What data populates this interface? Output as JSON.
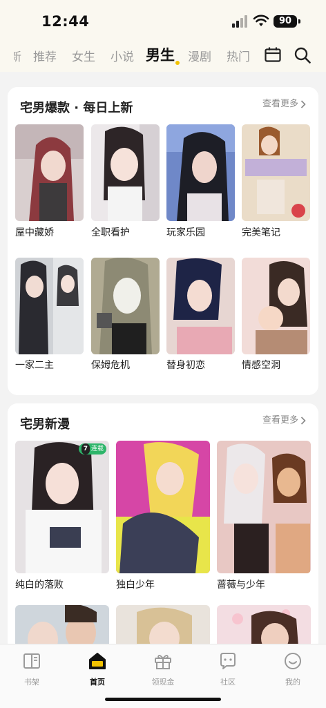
{
  "status": {
    "time": "12:44",
    "battery": "90"
  },
  "nav": {
    "tabs": [
      "新",
      "推荐",
      "女生",
      "小说",
      "男生",
      "漫剧",
      "热门"
    ],
    "active": "男生",
    "calendar_icon": "calendar-icon",
    "search_icon": "search-icon"
  },
  "section1": {
    "title": "宅男爆款 · 每日上新",
    "more": "查看更多",
    "items": [
      {
        "title": "屋中藏娇"
      },
      {
        "title": "全职看护"
      },
      {
        "title": "玩家乐园"
      },
      {
        "title": "完美笔记"
      },
      {
        "title": "一家二主"
      },
      {
        "title": "保姆危机"
      },
      {
        "title": "替身初恋"
      },
      {
        "title": "情感空洞"
      }
    ]
  },
  "section2": {
    "title": "宅男新漫",
    "more": "查看更多",
    "badge_num": "7",
    "badge_text": "连载",
    "items": [
      {
        "title": "纯白的落败"
      },
      {
        "title": "独白少年"
      },
      {
        "title": "蔷薇与少年"
      }
    ]
  },
  "tabbar": {
    "items": [
      "书架",
      "首页",
      "领现金",
      "社区",
      "我的"
    ],
    "active": "首页"
  },
  "colors": {
    "accent": "#f2c200",
    "badge": "#2db56a"
  }
}
